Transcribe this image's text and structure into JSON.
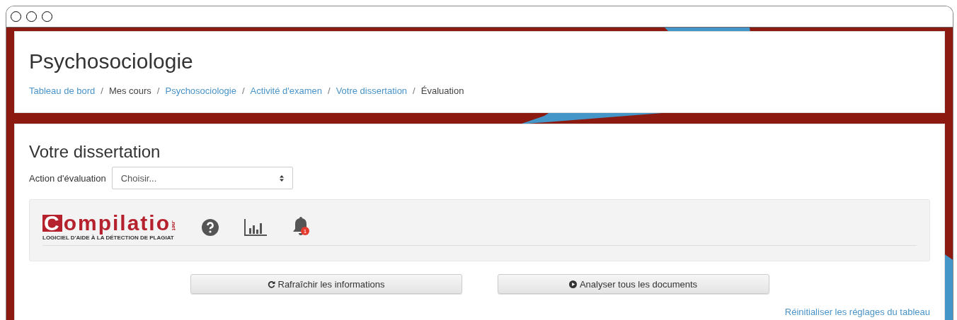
{
  "header": {
    "title": "Psychosociologie",
    "separator": "/",
    "breadcrumb": [
      {
        "label": "Tableau de bord",
        "link": true
      },
      {
        "label": "Mes cours",
        "link": false
      },
      {
        "label": "Psychosociologie",
        "link": true
      },
      {
        "label": "Activité d'examen",
        "link": true
      },
      {
        "label": "Votre dissertation",
        "link": true
      },
      {
        "label": "Évaluation",
        "link": false
      }
    ]
  },
  "assignment": {
    "title": "Votre dissertation",
    "grading_action": {
      "label": "Action d'évaluation",
      "value": "Choisir..."
    }
  },
  "plugin": {
    "logo": {
      "name": "Compilatio",
      "suffix": ".net",
      "tagline": "LOGICIEL D'AIDE À LA DÉTECTION DE PLAGIAT"
    },
    "alerts_badge": "1"
  },
  "buttons": [
    {
      "label": "Rafraîchir les informations",
      "kind": "refresh"
    },
    {
      "label": "Analyser tous les documents",
      "kind": "play"
    }
  ],
  "reset_link": "Réinitialiser les réglages du tableau"
}
